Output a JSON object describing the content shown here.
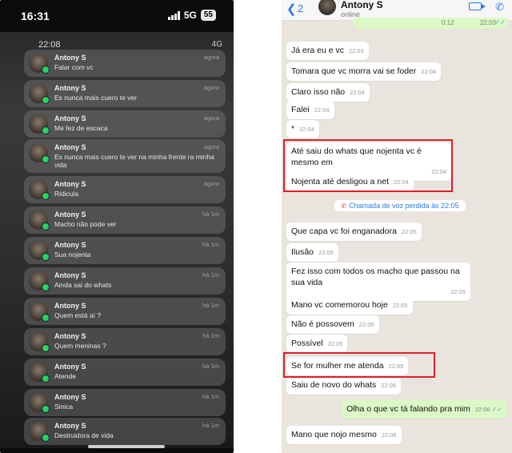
{
  "left": {
    "status": {
      "time": "16:31",
      "network": "5G",
      "battery": "55"
    },
    "mini_status": {
      "time": "22:08",
      "network": "4G"
    },
    "notifications": [
      {
        "name": "Antony S",
        "message": "Falar com vc",
        "time": "agora"
      },
      {
        "name": "Antony S",
        "message": "Es nunca mais cuero te ver",
        "time": "agora"
      },
      {
        "name": "Antony S",
        "message": "Me fez de escaca",
        "time": "agora"
      },
      {
        "name": "Antony S",
        "message": "Es nunca mais cuero te ver na minha frente ra minha vida",
        "time": "agora"
      },
      {
        "name": "Antony S",
        "message": "Ridicula",
        "time": "agora"
      },
      {
        "name": "Antony S",
        "message": "Macho não pode ver",
        "time": "há 1m"
      },
      {
        "name": "Antony S",
        "message": "Sua nojenta",
        "time": "há 1m"
      },
      {
        "name": "Antony S",
        "message": "Ainda sai do whats",
        "time": "há 1m"
      },
      {
        "name": "Antony S",
        "message": "Quem está aí ?",
        "time": "há 1m"
      },
      {
        "name": "Antony S",
        "message": "Quem meninas ?",
        "time": "há 1m"
      },
      {
        "name": "Antony S",
        "message": "Atende",
        "time": "há 1m"
      },
      {
        "name": "Antony S",
        "message": "Sinica",
        "time": "há 1m"
      },
      {
        "name": "Antony S",
        "message": "Destruidora de vida",
        "time": "há 1m"
      }
    ]
  },
  "right": {
    "header": {
      "back_count": "2",
      "name": "Antony S",
      "status": "online"
    },
    "voice": {
      "duration": "0:12",
      "time": "22:03"
    },
    "messages": [
      {
        "text": "Já era eu e vc",
        "time": "22:03",
        "dir": "in"
      },
      {
        "text": "Tomara que vc morra vai se foder",
        "time": "22:04",
        "dir": "in"
      },
      {
        "text": "Claro isso não",
        "time": "22:04",
        "dir": "in"
      },
      {
        "text": "Falei",
        "time": "22:04",
        "dir": "in"
      },
      {
        "text": "*",
        "time": "22:04",
        "dir": "in"
      },
      {
        "text": "Até saiu do whats que nojenta vc é mesmo em",
        "time": "22:04",
        "dir": "in"
      },
      {
        "text": "Nojenta até desligou a net",
        "time": "22:04",
        "dir": "in"
      },
      {
        "text": "Que capa vc foi enganadora",
        "time": "22:05",
        "dir": "in"
      },
      {
        "text": "Ilusão",
        "time": "22:05",
        "dir": "in"
      },
      {
        "text": "Fez isso com todos os macho que passou na sua vida",
        "time": "22:05",
        "dir": "in"
      },
      {
        "text": "Mano vc comemorou hoje",
        "time": "22:05",
        "dir": "in"
      },
      {
        "text": "Não é possovem",
        "time": "22:05",
        "dir": "in"
      },
      {
        "text": "Possível",
        "time": "22:05",
        "dir": "in"
      },
      {
        "text": "Se for mulher me atenda",
        "time": "22:05",
        "dir": "in"
      },
      {
        "text": "Saiu de novo do whats",
        "time": "22:06",
        "dir": "in"
      },
      {
        "text": "Olha o que vc tá falando pra mim",
        "time": "22:06",
        "dir": "out"
      },
      {
        "text": "Mano que nojo mesmo",
        "time": "22:06",
        "dir": "in"
      }
    ],
    "missed_call": "Chamada de voz perdida às 22:05"
  }
}
